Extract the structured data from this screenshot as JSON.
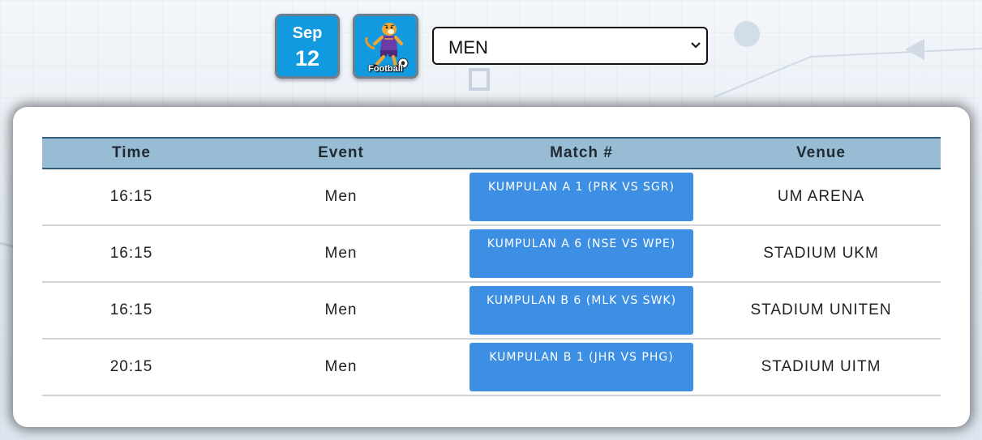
{
  "date": {
    "month": "Sep",
    "day": "12"
  },
  "sport": {
    "label": "Football",
    "icon": "tiger-mascot-football-icon"
  },
  "filter": {
    "selected": "MEN"
  },
  "table": {
    "headers": {
      "time": "Time",
      "event": "Event",
      "match": "Match #",
      "venue": "Venue"
    },
    "rows": [
      {
        "time": "16:15",
        "event": "Men",
        "match": "KUMPULAN A 1 (PRK VS SGR)",
        "venue": "UM ARENA"
      },
      {
        "time": "16:15",
        "event": "Men",
        "match": "KUMPULAN A 6 (NSE VS WPE)",
        "venue": "STADIUM UKM"
      },
      {
        "time": "16:15",
        "event": "Men",
        "match": "KUMPULAN B 6 (MLK VS SWK)",
        "venue": "STADIUM UNITEN"
      },
      {
        "time": "20:15",
        "event": "Men",
        "match": "KUMPULAN B 1 (JHR VS PHG)",
        "venue": "STADIUM UITM"
      }
    ]
  },
  "colors": {
    "badge": "#119ae0",
    "header_row": "#98bcd4",
    "match_button": "#3d8fe3"
  }
}
